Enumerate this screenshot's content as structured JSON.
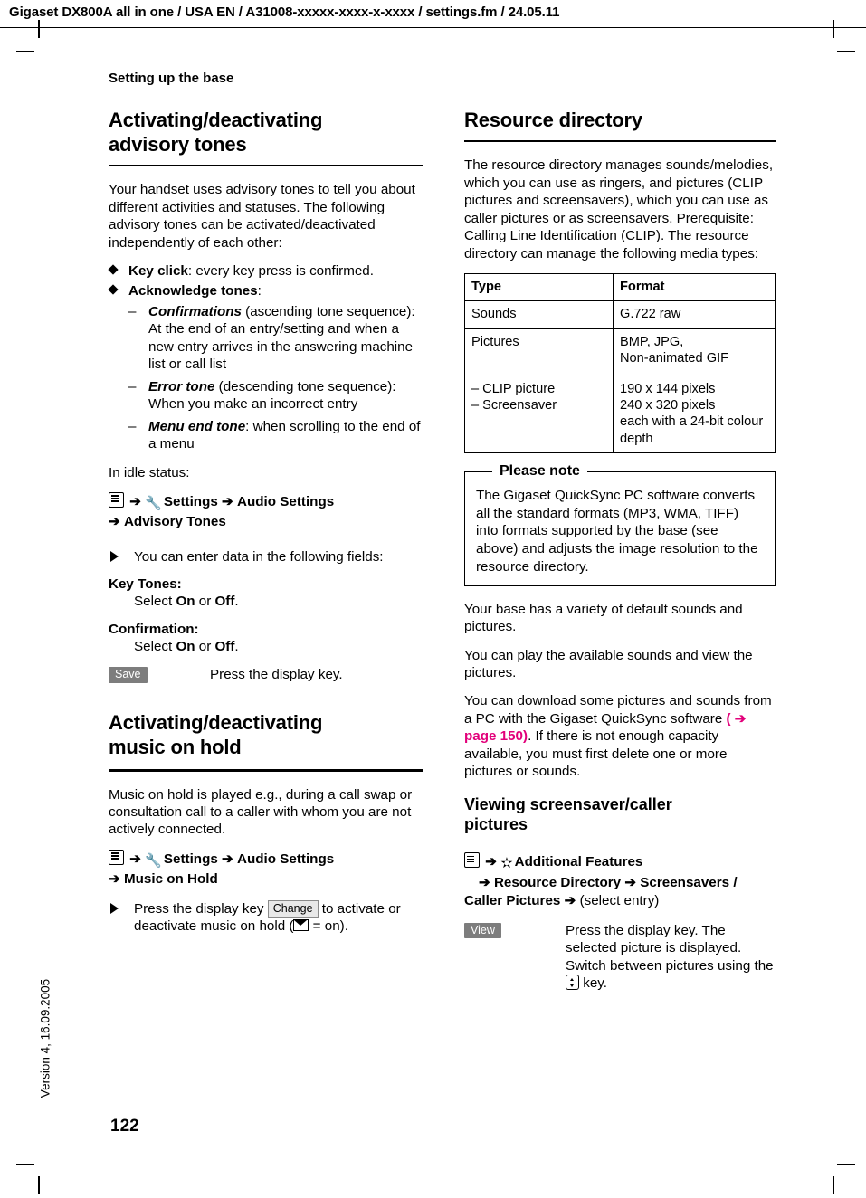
{
  "header": {
    "doc_line": "Gigaset DX800A all in one / USA EN / A31008-xxxxx-xxxx-x-xxxx / settings.fm / 24.05.11",
    "running_head": "Setting up the base",
    "side_version": "Version 4, 16.09.2005",
    "page_number": "122"
  },
  "left": {
    "section1": {
      "title_line1": "Activating/deactivating",
      "title_line2": "advisory tones",
      "intro": "Your handset uses advisory tones to tell you about different activities and statuses. The following advisory tones can be activated/deactivated independently of each other:",
      "bullets": [
        {
          "lead": "Key click",
          "rest": ": every key press is confirmed."
        },
        {
          "lead": "Acknowledge tones",
          "rest": ":"
        }
      ],
      "sub_bullets": [
        {
          "lead": "Confirmations",
          "rest": " (ascending tone sequence): At the end of an entry/setting and when  a new entry arrives in the answering machine list or call list"
        },
        {
          "lead": "Error tone",
          "rest": " (descending tone sequence): When you make an incorrect entry"
        },
        {
          "lead": "Menu end tone",
          "rest": ": when scrolling to the end of a menu"
        }
      ],
      "idle_label": "In idle status:",
      "path_line1_items": [
        "Settings",
        "Audio Settings"
      ],
      "path_line2_items": [
        "Advisory Tones"
      ],
      "fields_intro": "You can enter data in the following fields:",
      "field1_label": "Key Tones:",
      "field1_value_prefix": "Select ",
      "field1_value_on": "On",
      "field1_value_or": " or ",
      "field1_value_off": "Off",
      "field1_value_suffix": ".",
      "field2_label": "Confirmation:",
      "field2_value_prefix": "Select ",
      "field2_value_on": "On",
      "field2_value_or": " or ",
      "field2_value_off": "Off",
      "field2_value_suffix": ".",
      "save_key": "Save",
      "save_text": "Press the display key."
    },
    "section2": {
      "title_line1": "Activating/deactivating",
      "title_line2": "music on hold",
      "intro": "Music on hold is played e.g., during a call swap or consultation call to a caller with whom you are not actively connected.",
      "path_line1_items": [
        "Settings",
        "Audio Settings"
      ],
      "path_line2_items": [
        "Music on Hold"
      ],
      "change_pre": "Press the display key ",
      "change_key": "Change",
      "change_mid": " to activate or deactivate music on hold (",
      "change_post": " = on)."
    }
  },
  "right": {
    "title": "Resource directory",
    "intro": "The resource directory manages sounds/melodies, which you can use as ringers, and pictures (CLIP pictures and screensavers), which you can use as caller pictures or as screensavers. Prerequisite: Calling Line Identification (CLIP). The resource directory can manage the following media types:",
    "table": {
      "headers": [
        "Type",
        "Format"
      ],
      "rows": [
        {
          "type": "Sounds",
          "format": "G.722 raw"
        },
        {
          "type": "Pictures",
          "format": "BMP, JPG,\nNon-animated GIF"
        },
        {
          "type": "–    CLIP picture\n–    Screensaver",
          "format": "190 x 144 pixels\n240 x 320 pixels\neach with a 24-bit colour depth"
        }
      ]
    },
    "note": {
      "title": "Please note",
      "text": "The Gigaset QuickSync PC software converts all the standard formats (MP3, WMA, TIFF) into formats supported by the base (see above) and adjusts the image resolution to the resource directory."
    },
    "para1": "Your base has a variety of default sounds and pictures.",
    "para2": "You can play the available sounds and view the pictures.",
    "para3_pre": "You can download some pictures and sounds from a PC with the Gigaset QuickSync software ",
    "para3_xref": "( ➔  page 150)",
    "para3_post": ". If there is not enough capacity available, you must first delete one or more pictures or sounds.",
    "subsection": {
      "title_line1": "Viewing screensaver/caller",
      "title_line2": "pictures",
      "path_line1_items": [
        "Additional Features"
      ],
      "path_line2_items": [
        "Resource Directory",
        "Screensavers /"
      ],
      "path_line3_items": [
        "Caller Pictures",
        "(select entry)"
      ],
      "view_key": "View",
      "view_text_1": "Press the display key. The selected picture is displayed. Switch between pictures using the ",
      "view_text_2": " key."
    }
  }
}
